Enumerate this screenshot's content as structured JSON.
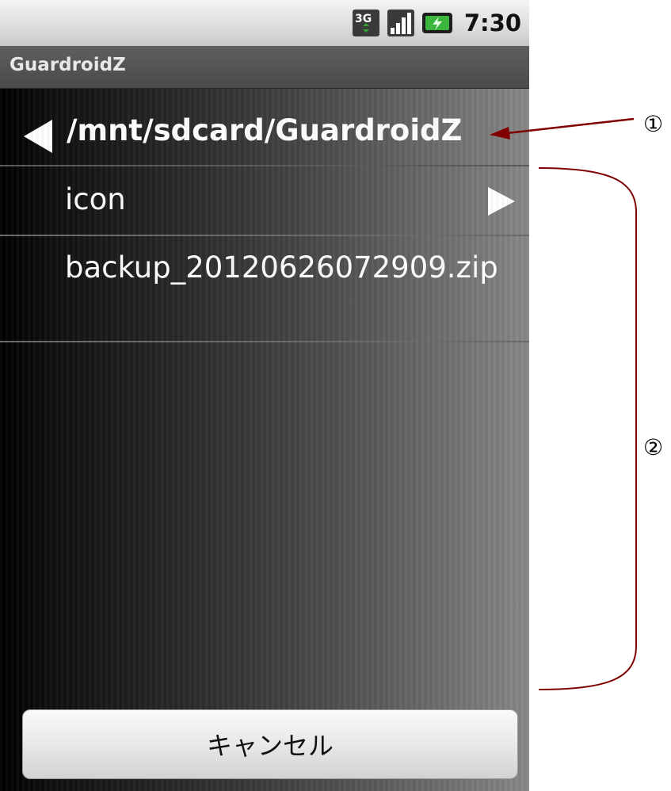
{
  "status_bar": {
    "network_icon": "3g-data-icon",
    "signal_icon": "signal-strength-icon",
    "battery_icon": "battery-charging-icon",
    "time": "7:30"
  },
  "title_bar": {
    "app_title": "GuardroidZ"
  },
  "navigator": {
    "current_path": "/mnt/sdcard/GuardroidZ",
    "back_icon": "back-triangle-icon"
  },
  "file_list": {
    "items": [
      {
        "name": "icon",
        "type": "folder",
        "icon": "forward-triangle-icon"
      },
      {
        "name": "backup_20120626072909.zip",
        "type": "file"
      }
    ]
  },
  "buttons": {
    "cancel_label": "キャンセル"
  },
  "annotations": {
    "callout_1": "①",
    "callout_2": "②",
    "arrow_color": "#800000",
    "bracket_color": "#800000"
  }
}
